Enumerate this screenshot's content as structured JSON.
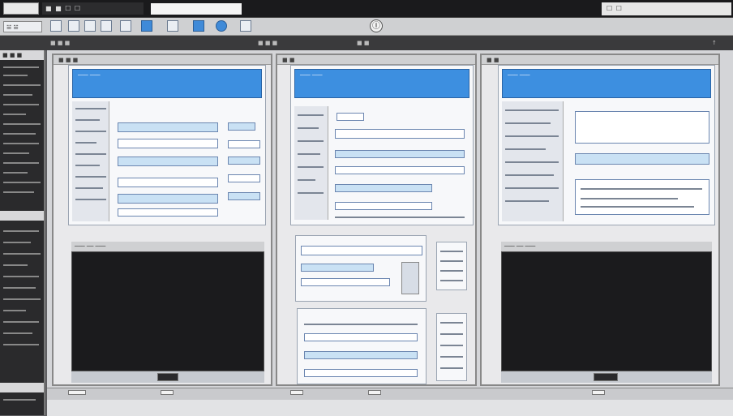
{
  "titlebar": {
    "left_label": "",
    "mid_label": "■ ■ ☐ ☐",
    "address": "",
    "right_label": "☐ ☐"
  },
  "toolbar": {
    "app_label": "☱ ☱",
    "center_glyph": "Ⓘ"
  },
  "tabrow": {
    "tab1": "■ ■ ■",
    "tab2": "■ ■ ■",
    "tab3": "■ ■",
    "tab4": "↑"
  },
  "leftpanel": {
    "header": "■ ■ ■"
  },
  "panels": [
    {
      "head": "■ ■ ■",
      "blue_title": "─── ───",
      "dark_head": "─── ── ───"
    },
    {
      "head": "■ ■",
      "blue_title": "─── ───",
      "dark_head": ""
    },
    {
      "head": "■ ■",
      "blue_title": "─── ───",
      "dark_head": "─── ── ───"
    }
  ],
  "colors": {
    "accent": "#3d8fe0",
    "chrome": "#5f5f62",
    "dark": "#1b1b1d"
  }
}
